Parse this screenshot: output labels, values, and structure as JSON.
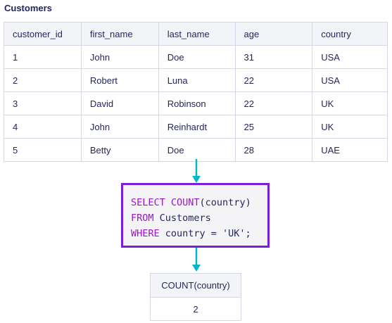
{
  "title": "Customers",
  "table": {
    "columns": [
      "customer_id",
      "first_name",
      "last_name",
      "age",
      "country"
    ],
    "rows": [
      [
        "1",
        "John",
        "Doe",
        "31",
        "USA"
      ],
      [
        "2",
        "Robert",
        "Luna",
        "22",
        "USA"
      ],
      [
        "3",
        "David",
        "Robinson",
        "22",
        "UK"
      ],
      [
        "4",
        "John",
        "Reinhardt",
        "25",
        "UK"
      ],
      [
        "5",
        "Betty",
        "Doe",
        "28",
        "UAE"
      ]
    ]
  },
  "query": {
    "line1_kw": "SELECT COUNT",
    "line1_rest": "(country)",
    "line2_kw": "FROM",
    "line2_rest": " Customers",
    "line3_kw": "WHERE",
    "line3_rest": " country = 'UK';"
  },
  "result": {
    "header": "COUNT(country)",
    "value": "2"
  },
  "colors": {
    "arrow": "#00b8c8",
    "query_border": "#7b1fd6",
    "keyword": "#9b16c8",
    "text": "#25265e"
  }
}
